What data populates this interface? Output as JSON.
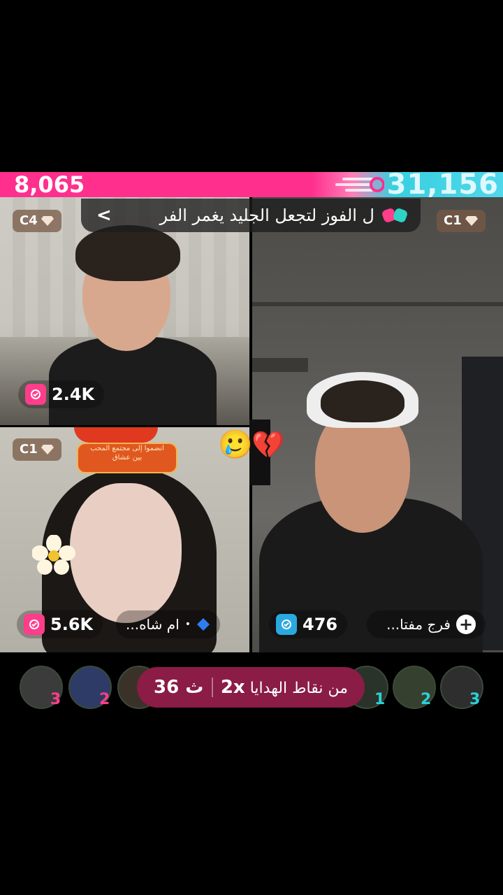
{
  "score": {
    "left": "8,065",
    "right": "31,156"
  },
  "banner": {
    "text": "ل الفوز لتجعل الجليد يغمر الفر",
    "arrow": "<"
  },
  "guests": [
    {
      "badge": "C4",
      "gifts": "2.4K",
      "gift_color": "#ff3d8b"
    },
    {
      "badge": "C1",
      "gifts": "5.6K",
      "gift_color": "#ff3d8b",
      "name": "ام شاه..."
    },
    {
      "badge": "C1",
      "gifts": "476",
      "gift_color": "#2aa8e0",
      "name": "فرج مفتا..."
    }
  ],
  "overlay_sticker": {
    "line1": "انضموا إلى مجتمع المحب",
    "line2": "بين عشاق"
  },
  "emoji": {
    "crying": "🥲",
    "broken_heart": "💔"
  },
  "bottom": {
    "left_ranks": [
      "3",
      "2"
    ],
    "right_ranks": [
      "1",
      "2",
      "3"
    ],
    "multiplier": "2x",
    "multiplier_text": "من نقاط الهدايا",
    "timer": "36 ث"
  },
  "colors": {
    "pink": "#ff2f8e",
    "cyan": "#4fd7ea",
    "timer_bg": "#8a1c46"
  },
  "icons": [
    "gift-icon",
    "diamond-icon",
    "plus-icon",
    "gloves-icon",
    "chevron-left-icon"
  ]
}
